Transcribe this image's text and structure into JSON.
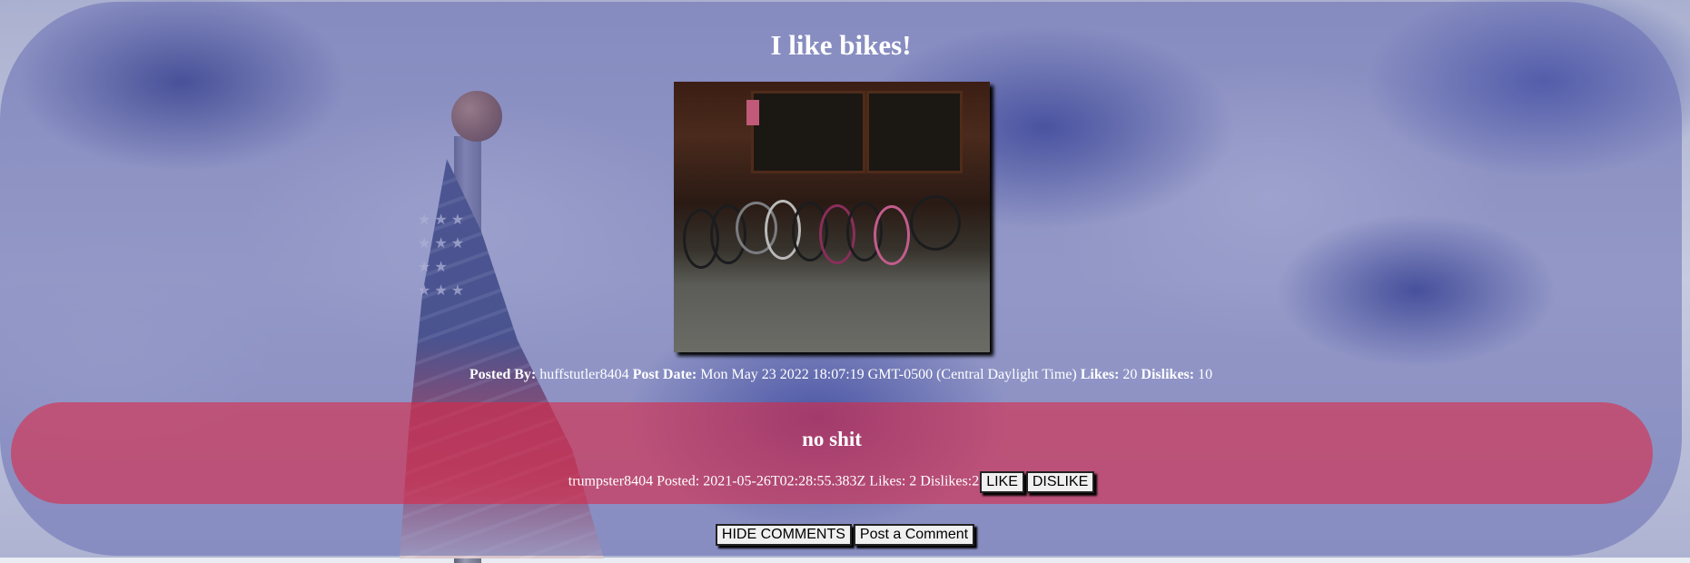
{
  "post": {
    "title": "I like bikes!",
    "image_alt": "bicycles parked in a rack",
    "meta": {
      "posted_by_label": "Posted By:",
      "author": "huffstutler8404",
      "post_date_label": "Post Date:",
      "post_date": "Mon May 23 2022 18:07:19 GMT-0500 (Central Daylight Time)",
      "likes_label": "Likes:",
      "likes": "20",
      "dislikes_label": "Dislikes:",
      "dislikes": "10"
    }
  },
  "comments": [
    {
      "title": "no shit",
      "author": "trumpster8404",
      "posted_label": "Posted:",
      "posted": "2021-05-26T02:28:55.383Z",
      "likes_label": "Likes:",
      "likes": "2",
      "dislikes_label": "Dislikes:",
      "dislikes": "2",
      "like_button": "LIKE",
      "dislike_button": "DISLIKE"
    }
  ],
  "actions": {
    "hide_comments": "HIDE COMMENTS",
    "post_comment": "Post a Comment"
  },
  "colors": {
    "post_bg": "#686eb2",
    "comment_bg": "#dc2846",
    "text": "#ffffff"
  }
}
